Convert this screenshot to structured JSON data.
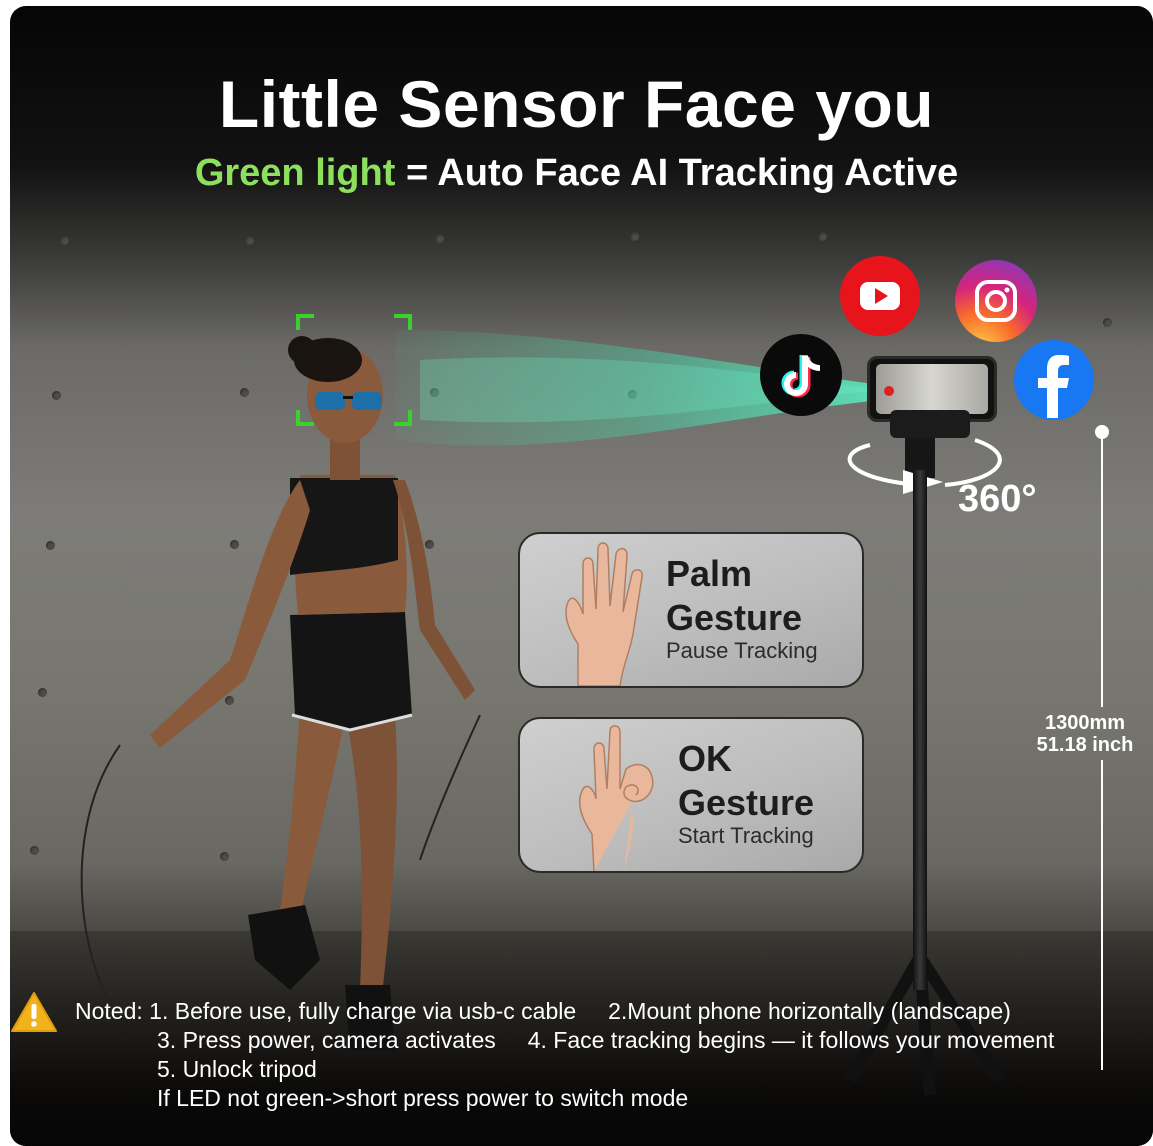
{
  "headline": {
    "title": "Little Sensor Face you",
    "subtitle_green": "Green light",
    "subtitle_rest": " = Auto Face AI Tracking Active"
  },
  "gestures": [
    {
      "title_line1": "Palm",
      "title_line2": "Gesture",
      "sub": "Pause Tracking",
      "icon": "palm-hand-icon"
    },
    {
      "title_line1": "OK",
      "title_line2": "Gesture",
      "sub": "Start Tracking",
      "icon": "ok-hand-icon"
    }
  ],
  "rotation_label": "360°",
  "height": {
    "mm": "1300mm",
    "inch": "51.18 inch"
  },
  "social_icons": [
    "youtube-icon",
    "instagram-icon",
    "tiktok-icon",
    "facebook-icon"
  ],
  "notes": {
    "line1": "Noted: 1. Before use, fully charge via usb-c cable     2.Mount phone horizontally (landscape)",
    "line2": "3. Press power, camera activates     4. Face tracking begins — it follows your movement",
    "line3": "5. Unlock tripod",
    "line4": "If LED not green->short press power to switch mode"
  },
  "colors": {
    "accent_green": "#8de05d",
    "tracking_box": "#3ad12e",
    "warning": "#f2b21b"
  }
}
